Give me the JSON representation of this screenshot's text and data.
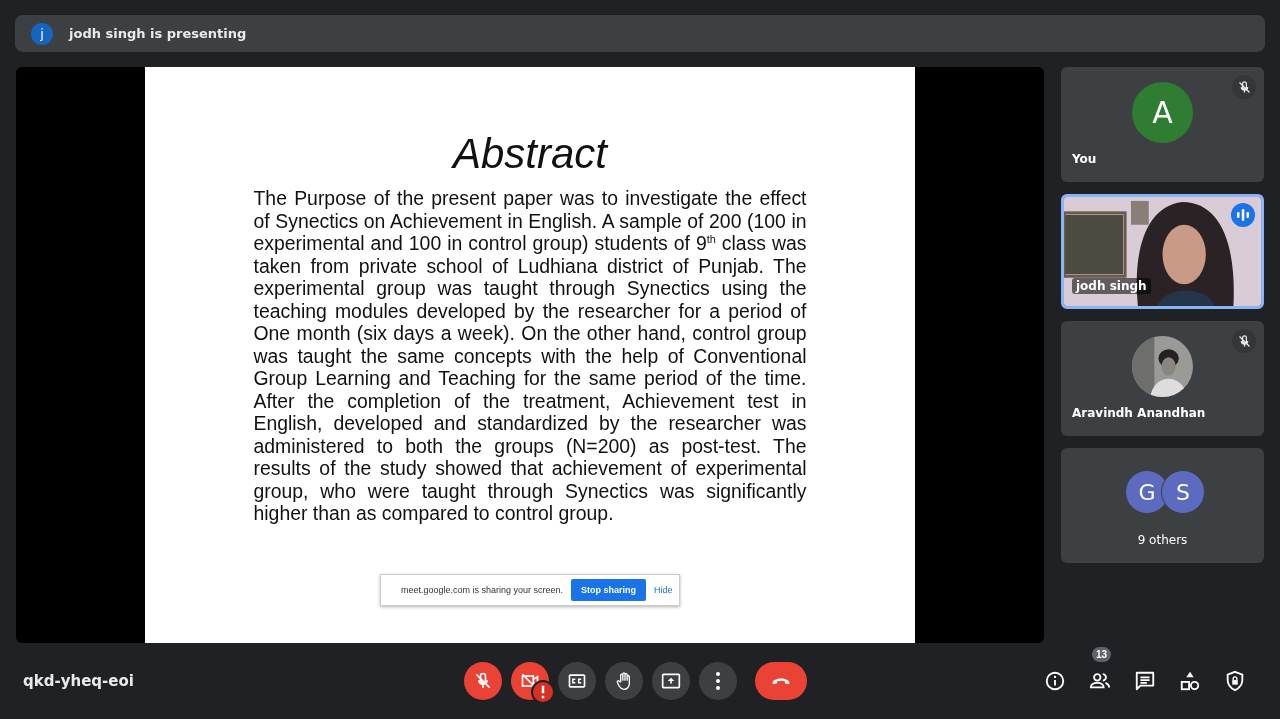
{
  "presenting_bar": {
    "avatar_letter": "j",
    "text": "jodh singh is presenting"
  },
  "slide": {
    "title": "Abstract",
    "body": "The Purpose of the present paper was to investigate the effect of Synectics on Achievement in English. A sample of 200 (100 in experimental and 100 in control group) students of 9$^{th}$ class was taken from private school of Ludhiana district of Punjab. The experimental group was taught through Synectics using the teaching modules developed by the researcher for a period of One month (six days a week). On the other hand, control group was taught the same concepts with the help of Conventional Group Learning and Teaching for the same period of the time. After the completion of the treatment, Achievement test in English, developed and standardized by the researcher was administered to both the groups (N=200) as post-test. The results of the study showed that achievement of experimental group, who were taught through Synectics was significantly higher than as compared to control group."
  },
  "sharing_notice": {
    "text": "meet.google.com is sharing your screen.",
    "stop_button": "Stop sharing",
    "hide_link": "Hide"
  },
  "tiles": [
    {
      "kind": "letter",
      "letter": "A",
      "color": "#2e7d32",
      "name": "You",
      "muted": true,
      "speaking": false
    },
    {
      "kind": "video",
      "name": "jodh singh",
      "muted": false,
      "speaking": true
    },
    {
      "name": "Aravindh Anandhan",
      "muted": true,
      "speaking": false
    },
    {
      "kind": "group",
      "letters": [
        "G",
        "S"
      ],
      "name": "9 others",
      "muted": false,
      "speaking": false
    }
  ],
  "meeting_code": "qkd-yheq-eoi",
  "controls": [
    {
      "kind": "mic",
      "on": false
    },
    {
      "kind": "camera",
      "on": false,
      "warning": true
    },
    {
      "kind": "captions"
    },
    {
      "kind": "hand"
    },
    {
      "kind": "present"
    },
    {
      "kind": "more"
    },
    {
      "kind": "hangup"
    }
  ],
  "side_buttons": [
    {
      "kind": "info"
    },
    {
      "kind": "people",
      "badge": "13"
    },
    {
      "kind": "chat"
    },
    {
      "kind": "activities"
    },
    {
      "kind": "safety"
    }
  ]
}
